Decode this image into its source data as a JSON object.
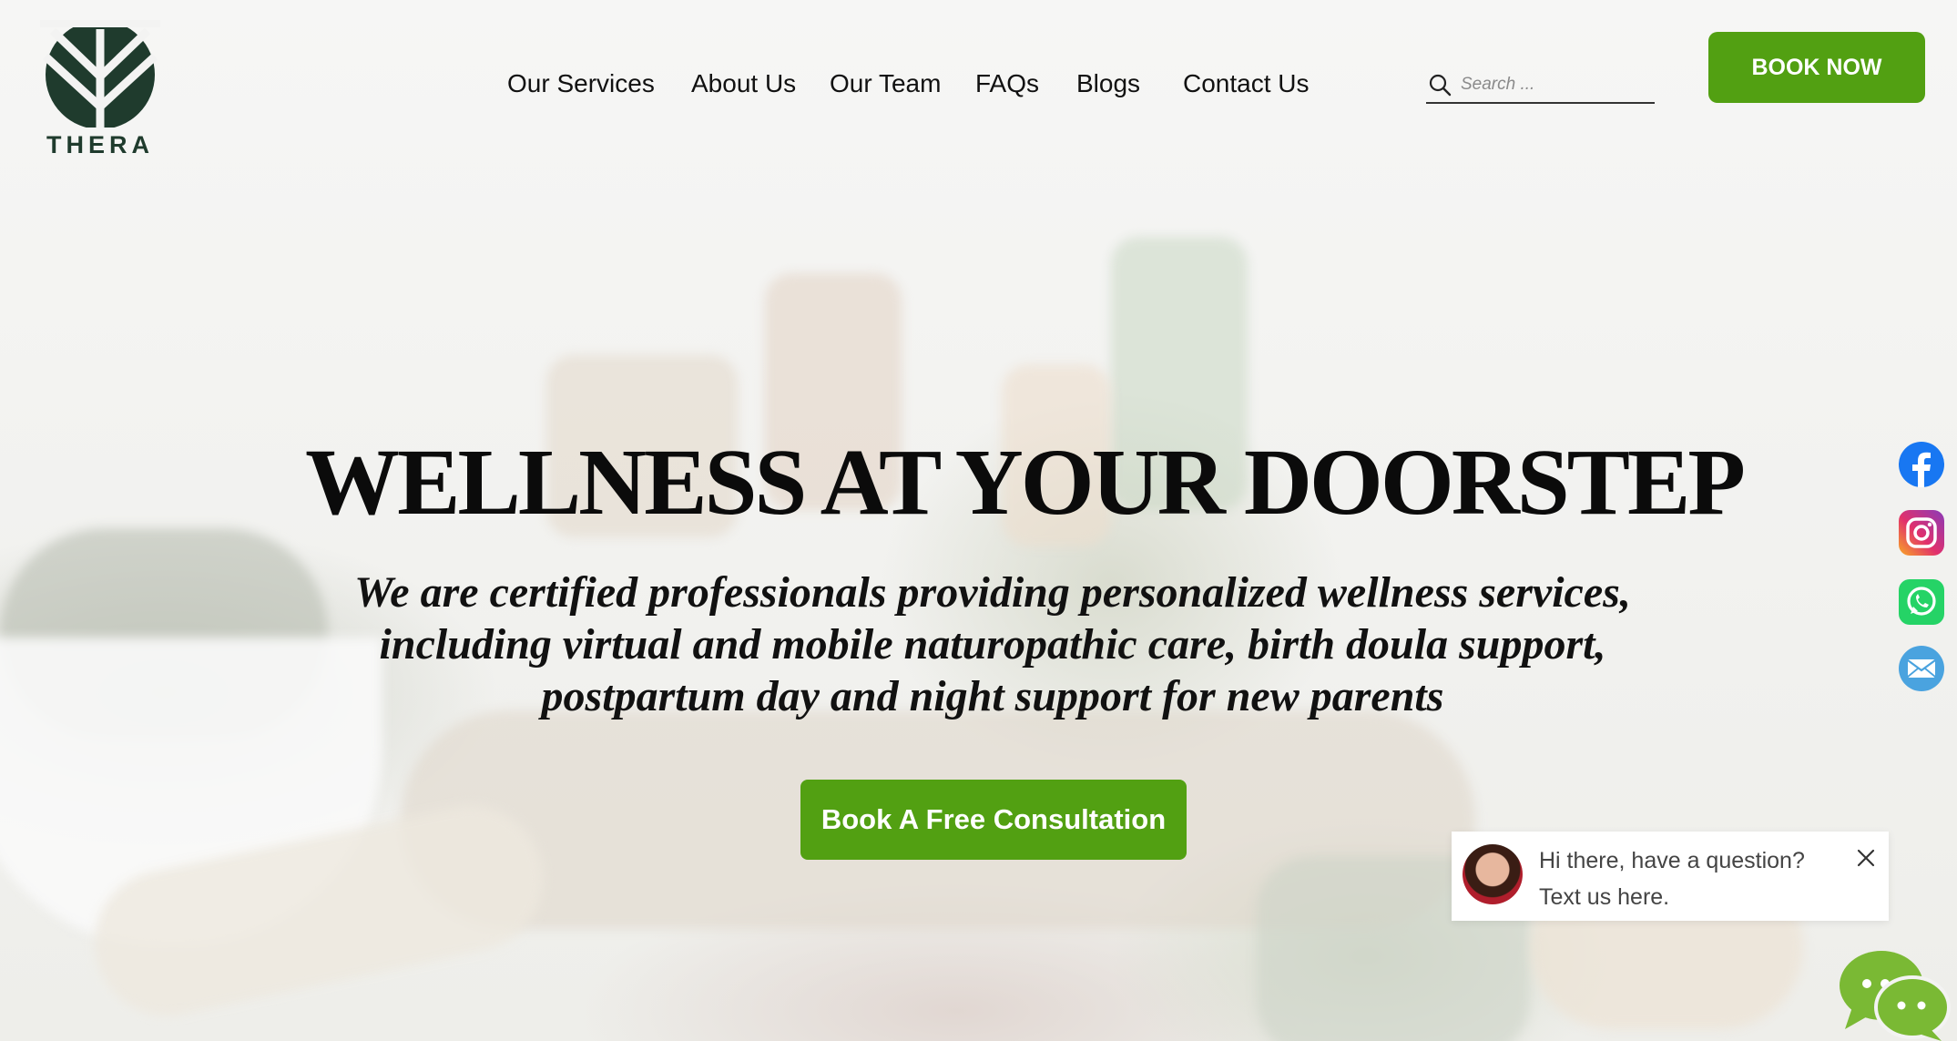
{
  "brand": {
    "name": "THERA",
    "color": "#1f3b2d"
  },
  "nav": {
    "items": [
      {
        "label": "Our Services"
      },
      {
        "label": "About Us"
      },
      {
        "label": "Our Team"
      },
      {
        "label": "FAQs"
      },
      {
        "label": "Blogs"
      },
      {
        "label": "Contact Us"
      }
    ]
  },
  "search": {
    "placeholder": "Search ...",
    "value": "",
    "icon": "search-icon"
  },
  "header": {
    "book_now_label": "BOOK NOW"
  },
  "hero": {
    "title": "WELLNESS AT YOUR DOORSTEP",
    "subtitle_lines": [
      "We are certified professionals providing personalized wellness services,",
      "including virtual and mobile naturopathic care, birth doula support,",
      "postpartum day and night support for new parents"
    ],
    "cta_label": "Book A Free Consultation"
  },
  "social": [
    {
      "name": "facebook-icon",
      "color": "#1877f2"
    },
    {
      "name": "instagram-icon",
      "color": "#e1306c"
    },
    {
      "name": "whatsapp-icon",
      "color": "#25d366"
    },
    {
      "name": "email-icon",
      "color": "#4aa3df"
    }
  ],
  "chat": {
    "line1": "Hi there, have a question?",
    "line2": "Text us here.",
    "icon": "chat-bubbles-icon",
    "bubble_color": "#7ab934"
  },
  "colors": {
    "accent": "#52a012",
    "text": "#111111"
  }
}
